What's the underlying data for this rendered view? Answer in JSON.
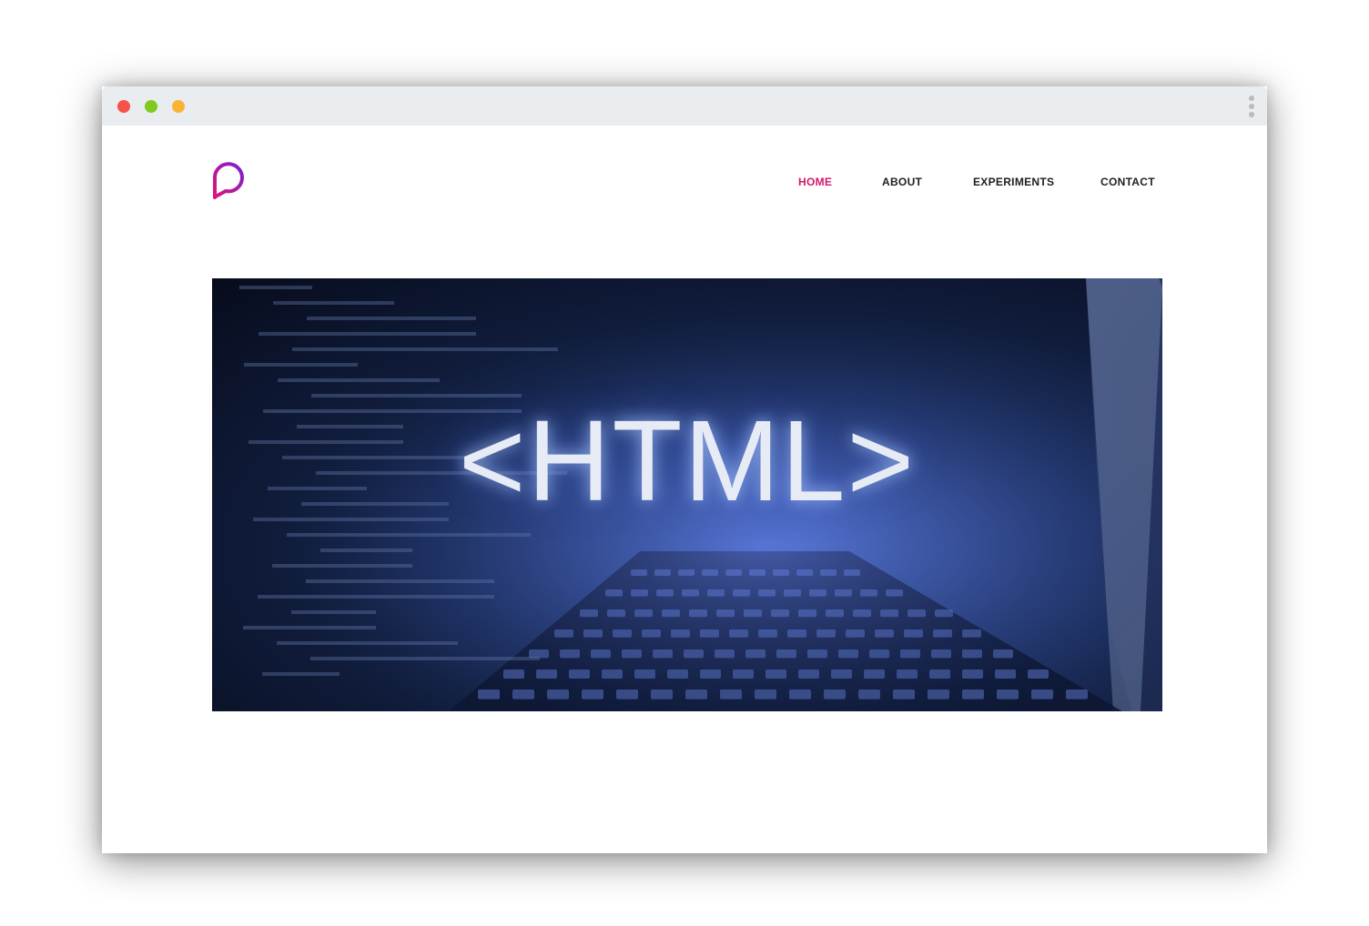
{
  "window": {
    "controls": [
      {
        "name": "close",
        "color": "#f5524b"
      },
      {
        "name": "maximize",
        "color": "#81c91e"
      },
      {
        "name": "minimize",
        "color": "#fbb336"
      }
    ],
    "menu_icon": "vertical-dots-icon"
  },
  "site": {
    "logo_icon": "speech-bubble-p-logo",
    "logo_colors": [
      "#e0147a",
      "#7b1fd1"
    ]
  },
  "nav": {
    "active_color": "#d6176c",
    "items": [
      {
        "label": "HOME",
        "active": true
      },
      {
        "label": "ABOUT",
        "active": false
      },
      {
        "label": "EXPERIMENTS",
        "active": false
      },
      {
        "label": "CONTACT",
        "active": false
      }
    ]
  },
  "hero": {
    "text": "<HTML>"
  }
}
